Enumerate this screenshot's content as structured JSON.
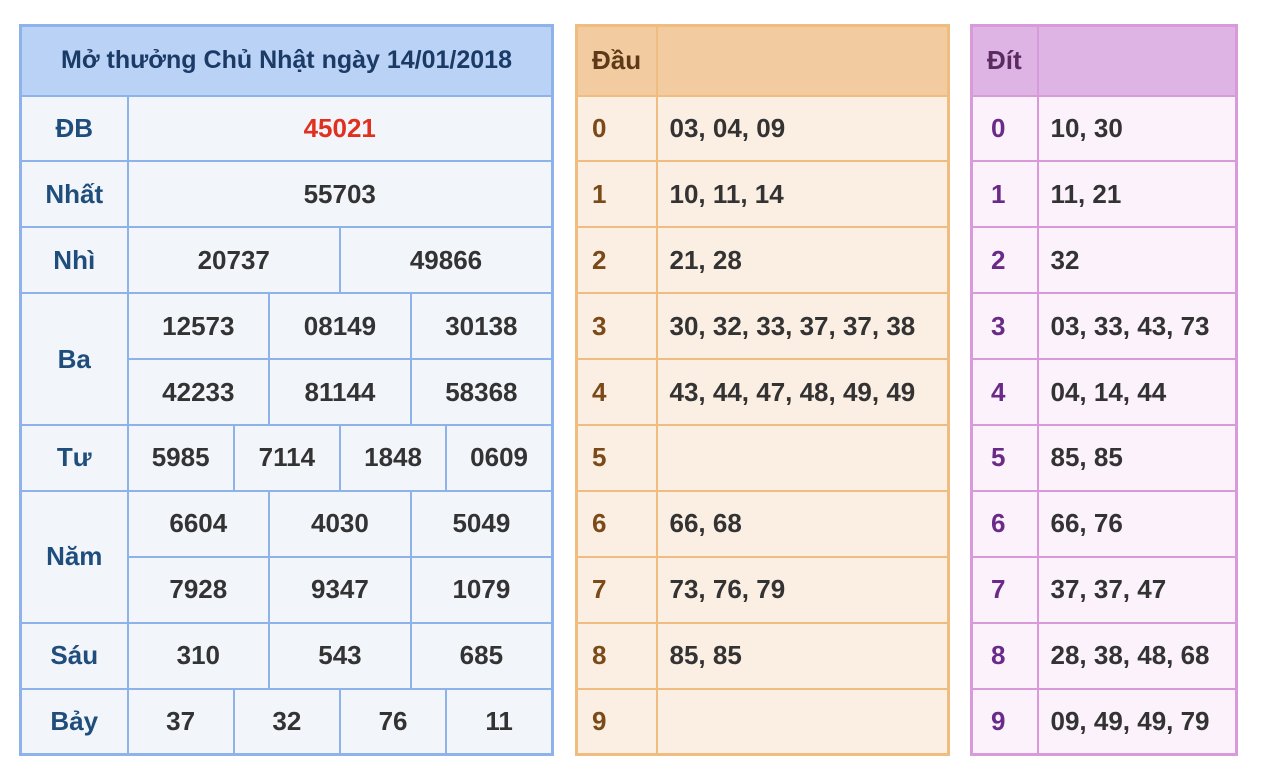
{
  "results": {
    "title": "Mở thưởng Chủ Nhật ngày 14/01/2018",
    "db": {
      "label": "ĐB",
      "values": [
        "45021"
      ]
    },
    "nhat": {
      "label": "Nhất",
      "values": [
        "55703"
      ]
    },
    "nhi": {
      "label": "Nhì",
      "values": [
        "20737",
        "49866"
      ]
    },
    "ba": {
      "label": "Ba",
      "values": [
        "12573",
        "08149",
        "30138",
        "42233",
        "81144",
        "58368"
      ]
    },
    "tu": {
      "label": "Tư",
      "values": [
        "5985",
        "7114",
        "1848",
        "0609"
      ]
    },
    "nam": {
      "label": "Năm",
      "values": [
        "6604",
        "4030",
        "5049",
        "7928",
        "9347",
        "1079"
      ]
    },
    "sau": {
      "label": "Sáu",
      "values": [
        "310",
        "543",
        "685"
      ]
    },
    "bay": {
      "label": "Bảy",
      "values": [
        "37",
        "32",
        "76",
        "11"
      ]
    }
  },
  "dau": {
    "header": "Đầu",
    "rows": [
      {
        "idx": "0",
        "vals": "03, 04, 09"
      },
      {
        "idx": "1",
        "vals": "10, 11, 14"
      },
      {
        "idx": "2",
        "vals": "21, 28"
      },
      {
        "idx": "3",
        "vals": "30, 32, 33, 37, 37, 38"
      },
      {
        "idx": "4",
        "vals": "43, 44, 47, 48, 49, 49"
      },
      {
        "idx": "5",
        "vals": ""
      },
      {
        "idx": "6",
        "vals": "66, 68"
      },
      {
        "idx": "7",
        "vals": "73, 76, 79"
      },
      {
        "idx": "8",
        "vals": "85, 85"
      },
      {
        "idx": "9",
        "vals": ""
      }
    ]
  },
  "dit": {
    "header": "Đít",
    "rows": [
      {
        "idx": "0",
        "vals": "10, 30"
      },
      {
        "idx": "1",
        "vals": "11, 21"
      },
      {
        "idx": "2",
        "vals": "32"
      },
      {
        "idx": "3",
        "vals": "03, 33, 43, 73"
      },
      {
        "idx": "4",
        "vals": "04, 14, 44"
      },
      {
        "idx": "5",
        "vals": "85, 85"
      },
      {
        "idx": "6",
        "vals": "66, 76"
      },
      {
        "idx": "7",
        "vals": "37, 37, 47"
      },
      {
        "idx": "8",
        "vals": "28, 38, 48, 68"
      },
      {
        "idx": "9",
        "vals": "09, 49, 49, 79"
      }
    ]
  },
  "colors": {
    "special": "#e03020",
    "results_border": "#8db3ea",
    "dau_border": "#f0bd80",
    "dit_border": "#d99ad9"
  }
}
